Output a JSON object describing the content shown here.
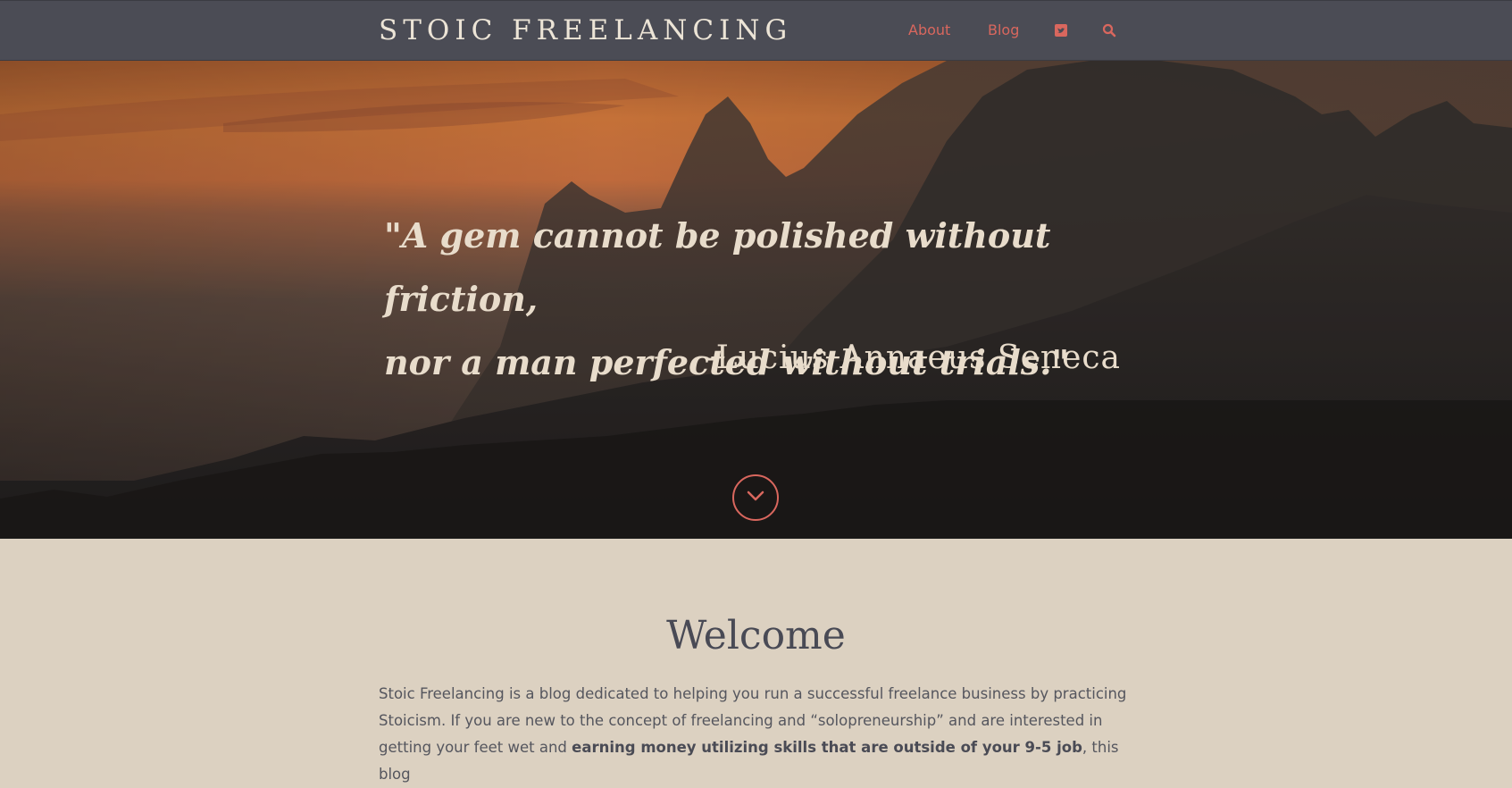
{
  "header": {
    "brand": "STOIC FREELANCING",
    "nav": {
      "about": "About",
      "blog": "Blog"
    },
    "icons": [
      "twitter-icon",
      "search-icon"
    ],
    "accent_color": "#d9675e",
    "background_color": "#4b4c55"
  },
  "hero": {
    "quote_line1": "\"A gem cannot be polished without friction,",
    "quote_line2": "nor a man perfected without trials.\"",
    "author": "-Lucius Annaeus Seneca",
    "scroll_icon": "chevron-down-icon"
  },
  "welcome": {
    "title": "Welcome",
    "body_part1": "Stoic Freelancing is a blog dedicated to helping you run a successful freelance business by practicing Stoicism. If you are new to the concept of freelancing and “solopreneurship” and are interested in getting your feet wet and ",
    "body_bold": "earning money utilizing skills that are outside of your 9-5 job",
    "body_part2": ", this blog"
  }
}
